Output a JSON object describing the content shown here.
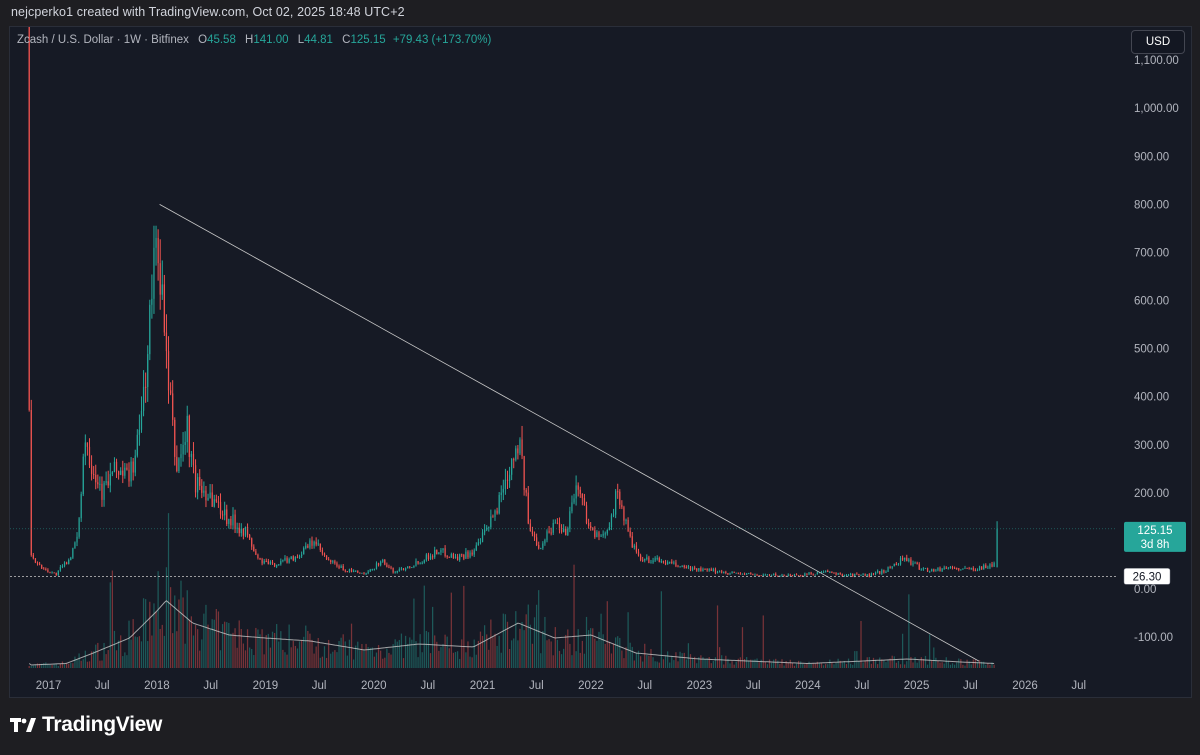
{
  "header": {
    "text": "nejcperko1 created with TradingView.com, Oct 02, 2025 18:48 UTC+2"
  },
  "legend": {
    "symbol": "Zcash / U.S. Dollar · 1W · Bitfinex",
    "open_label": "O",
    "open": "45.58",
    "high_label": "H",
    "high": "141.00",
    "low_label": "L",
    "low": "44.81",
    "close_label": "C",
    "close": "125.15",
    "change": "+79.43 (+173.70%)"
  },
  "currency_button": "USD",
  "footer": {
    "logo_text": "TradingView"
  },
  "colors": {
    "up": "#26a69a",
    "down": "#ef5350",
    "background": "#161a25",
    "trendline": "#c8c8c8",
    "volume_ma": "#c8c8c8"
  },
  "chart_data": {
    "type": "candlestick",
    "timeframe": "1W",
    "ylim": [
      -150,
      1100
    ],
    "y_ticks": [
      -100,
      0,
      100,
      200,
      300,
      400,
      500,
      600,
      700,
      800,
      900,
      1000,
      1100
    ],
    "y_tick_labels": [
      "-100.00",
      "0.00",
      "",
      "200.00",
      "300.00",
      "400.00",
      "500.00",
      "600.00",
      "700.00",
      "800.00",
      "900.00",
      "1,000.00",
      "1,100.00"
    ],
    "x_ticks": [
      {
        "label": "2017",
        "date": "2017-01-01"
      },
      {
        "label": "Jul",
        "date": "2017-07-01"
      },
      {
        "label": "2018",
        "date": "2018-01-01"
      },
      {
        "label": "Jul",
        "date": "2018-07-01"
      },
      {
        "label": "2019",
        "date": "2019-01-01"
      },
      {
        "label": "Jul",
        "date": "2019-07-01"
      },
      {
        "label": "2020",
        "date": "2020-01-01"
      },
      {
        "label": "Jul",
        "date": "2020-07-01"
      },
      {
        "label": "2021",
        "date": "2021-01-01"
      },
      {
        "label": "Jul",
        "date": "2021-07-01"
      },
      {
        "label": "2022",
        "date": "2022-01-01"
      },
      {
        "label": "Jul",
        "date": "2022-07-01"
      },
      {
        "label": "2023",
        "date": "2023-01-01"
      },
      {
        "label": "Jul",
        "date": "2023-07-01"
      },
      {
        "label": "2024",
        "date": "2024-01-01"
      },
      {
        "label": "Jul",
        "date": "2024-07-01"
      },
      {
        "label": "2025",
        "date": "2025-01-01"
      },
      {
        "label": "Jul",
        "date": "2025-07-01"
      },
      {
        "label": "2026",
        "date": "2026-01-01"
      },
      {
        "label": "Jul",
        "date": "2026-07-01"
      }
    ],
    "price_trajectory": [
      [
        "2016-10-28",
        1300
      ],
      [
        "2016-11-01",
        500
      ],
      [
        "2016-11-10",
        80
      ],
      [
        "2016-12-01",
        50
      ],
      [
        "2017-01-01",
        40
      ],
      [
        "2017-02-01",
        30
      ],
      [
        "2017-03-15",
        60
      ],
      [
        "2017-04-15",
        100
      ],
      [
        "2017-05-10",
        320
      ],
      [
        "2017-06-10",
        250
      ],
      [
        "2017-07-10",
        200
      ],
      [
        "2017-08-01",
        230
      ],
      [
        "2017-09-01",
        250
      ],
      [
        "2017-10-01",
        230
      ],
      [
        "2017-11-01",
        280
      ],
      [
        "2017-12-01",
        450
      ],
      [
        "2018-01-10",
        750
      ],
      [
        "2018-02-10",
        450
      ],
      [
        "2018-03-15",
        250
      ],
      [
        "2018-04-20",
        330
      ],
      [
        "2018-05-15",
        220
      ],
      [
        "2018-07-01",
        200
      ],
      [
        "2018-09-01",
        150
      ],
      [
        "2018-11-01",
        120
      ],
      [
        "2018-12-15",
        60
      ],
      [
        "2019-02-01",
        50
      ],
      [
        "2019-05-01",
        70
      ],
      [
        "2019-06-20",
        100
      ],
      [
        "2019-08-01",
        60
      ],
      [
        "2019-10-01",
        40
      ],
      [
        "2019-12-15",
        30
      ],
      [
        "2020-02-01",
        60
      ],
      [
        "2020-03-15",
        35
      ],
      [
        "2020-06-01",
        55
      ],
      [
        "2020-08-15",
        80
      ],
      [
        "2020-10-15",
        65
      ],
      [
        "2020-12-15",
        80
      ],
      [
        "2021-02-15",
        150
      ],
      [
        "2021-05-10",
        320
      ],
      [
        "2021-06-15",
        120
      ],
      [
        "2021-07-20",
        90
      ],
      [
        "2021-09-10",
        140
      ],
      [
        "2021-10-15",
        120
      ],
      [
        "2021-11-20",
        220
      ],
      [
        "2022-01-10",
        120
      ],
      [
        "2022-02-15",
        100
      ],
      [
        "2022-04-10",
        200
      ],
      [
        "2022-05-15",
        110
      ],
      [
        "2022-06-20",
        60
      ],
      [
        "2022-08-15",
        60
      ],
      [
        "2022-10-15",
        50
      ],
      [
        "2023-01-01",
        40
      ],
      [
        "2023-04-01",
        35
      ],
      [
        "2023-07-01",
        30
      ],
      [
        "2023-10-15",
        28
      ],
      [
        "2024-01-01",
        30
      ],
      [
        "2024-03-01",
        35
      ],
      [
        "2024-05-01",
        30
      ],
      [
        "2024-08-01",
        28
      ],
      [
        "2024-10-01",
        40
      ],
      [
        "2024-11-25",
        65
      ],
      [
        "2025-01-15",
        45
      ],
      [
        "2025-03-01",
        38
      ],
      [
        "2025-05-01",
        45
      ],
      [
        "2025-06-15",
        40
      ],
      [
        "2025-08-15",
        45
      ],
      [
        "2025-09-20",
        50
      ]
    ],
    "last_candle": {
      "date": "2025-09-29",
      "open": 45.58,
      "high": 141.0,
      "low": 44.81,
      "close": 125.15
    },
    "price_label": {
      "value": "125.15",
      "countdown": "3d 8h"
    },
    "horizontal_line": {
      "value": "26.30"
    },
    "trendline": {
      "start": [
        "2018-01-10",
        800
      ],
      "end": [
        "2025-07-30",
        -150
      ]
    },
    "volume_ma_trajectory": [
      [
        "2016-11-01",
        0.02
      ],
      [
        "2017-03-01",
        0.03
      ],
      [
        "2017-06-01",
        0.1
      ],
      [
        "2017-10-01",
        0.2
      ],
      [
        "2018-01-01",
        0.38
      ],
      [
        "2018-02-01",
        0.45
      ],
      [
        "2018-05-01",
        0.3
      ],
      [
        "2018-09-01",
        0.22
      ],
      [
        "2019-01-01",
        0.2
      ],
      [
        "2019-06-01",
        0.18
      ],
      [
        "2019-12-01",
        0.12
      ],
      [
        "2020-06-01",
        0.16
      ],
      [
        "2020-12-01",
        0.14
      ],
      [
        "2021-05-01",
        0.3
      ],
      [
        "2021-09-01",
        0.2
      ],
      [
        "2022-01-01",
        0.22
      ],
      [
        "2022-06-01",
        0.1
      ],
      [
        "2023-01-01",
        0.06
      ],
      [
        "2024-01-01",
        0.03
      ],
      [
        "2024-12-01",
        0.06
      ],
      [
        "2025-06-01",
        0.04
      ],
      [
        "2025-09-20",
        0.03
      ]
    ]
  }
}
